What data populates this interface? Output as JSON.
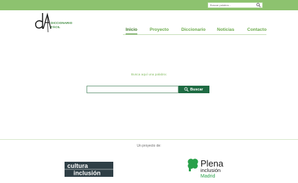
{
  "top_search": {
    "placeholder": "Buscar palabra..."
  },
  "logo": {
    "line1": "DICCIONARIO",
    "line2": "FÁCIL"
  },
  "nav": [
    {
      "label": "Inicio",
      "active": true
    },
    {
      "label": "Proyecto"
    },
    {
      "label": "Diccionario"
    },
    {
      "label": "Noticias"
    },
    {
      "label": "Contacto"
    }
  ],
  "search": {
    "hint": "Busca aquí una palabra:",
    "value": "",
    "button_label": "Buscar"
  },
  "footer": {
    "byline": "Un proyecto de:",
    "partner1": {
      "line1": "cultura",
      "line2": "inclusión"
    },
    "partner2": {
      "line1": "Plena",
      "line2": "inclusión",
      "line3": "Madrid"
    }
  },
  "colors": {
    "accent": "#8dc26f",
    "dark_green": "#1f6b43",
    "nav_text": "#6aaa4a"
  }
}
